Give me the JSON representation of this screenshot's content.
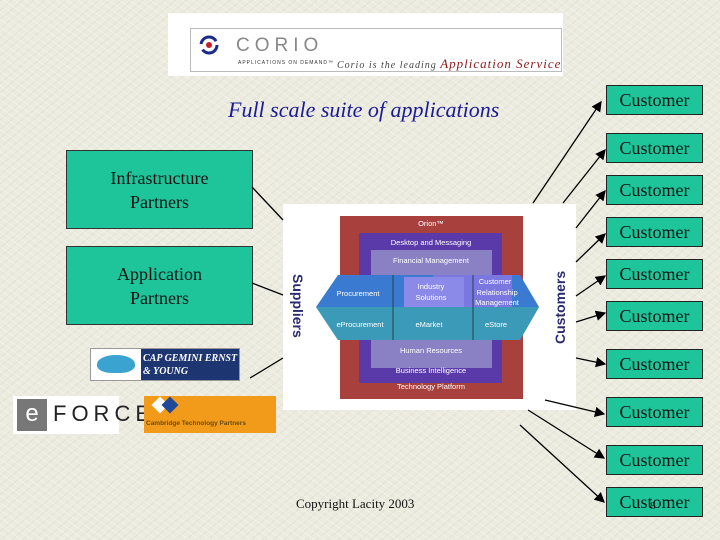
{
  "logo": {
    "brand": "CORIO",
    "tagline": "APPLICATIONS ON DEMAND™",
    "slogan": "Corio is the leading",
    "slogan_highlight": "Application Service"
  },
  "title": "Full scale suite of applications",
  "partners": [
    {
      "label_line1": "Infrastructure",
      "label_line2": "Partners"
    },
    {
      "label_line1": "Application",
      "label_line2": "Partners"
    }
  ],
  "partner_logos": {
    "capgemini": "CAP GEMINI ERNST & YOUNG",
    "eforce": "e FORCE",
    "cambridge": "Cambridge Technology Partners"
  },
  "diagram": {
    "orion": "Orion™",
    "desktop": "Desktop and Messaging",
    "financial": "Financial Management",
    "procurement": "Procurement",
    "industry": "Industry Solutions",
    "crm": "Customer Relationship Management",
    "eprocurement": "eProcurement",
    "emarket": "eMarket",
    "estore": "eStore",
    "hr": "Human Resources",
    "bi": "Business Intelligence",
    "tech": "Technology Platform",
    "suppliers": "Suppliers",
    "customers": "Customers"
  },
  "customers": [
    "Customer",
    "Customer",
    "Customer",
    "Customer",
    "Customer",
    "Customer",
    "Customer",
    "Customer",
    "Customer",
    "Customer"
  ],
  "footer": {
    "copyright": "Copyright Lacity 2003",
    "page_number": "8"
  },
  "colors": {
    "box": "#1fc59a",
    "title": "#1a1a9a"
  }
}
